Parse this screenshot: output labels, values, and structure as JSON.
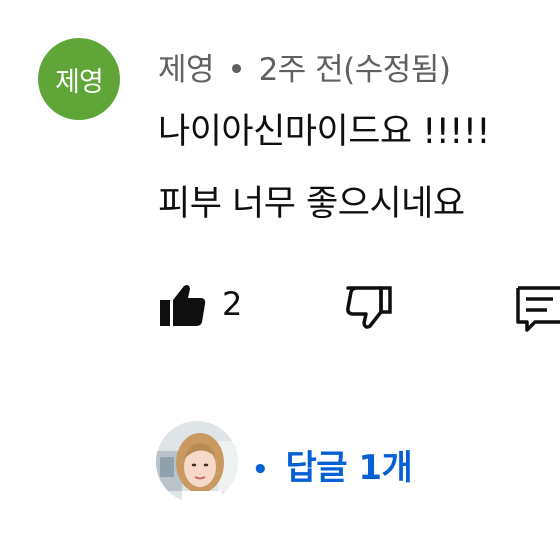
{
  "comment": {
    "avatar_text": "제영",
    "avatar_color": "#5fa538",
    "author": "제영",
    "separator": "•",
    "time": "2주 전(수정됨)",
    "lines": [
      "나이아신마이드요 !!!!!",
      "피부 너무 좋으시네요"
    ]
  },
  "actions": {
    "like_icon": "thumbs-up-filled-icon",
    "like_count": "2",
    "dislike_icon": "thumbs-down-outline-icon",
    "reply_icon": "reply-comment-icon"
  },
  "replies": {
    "bullet": "•",
    "label": "답글 1개",
    "color": "#065fd4"
  }
}
